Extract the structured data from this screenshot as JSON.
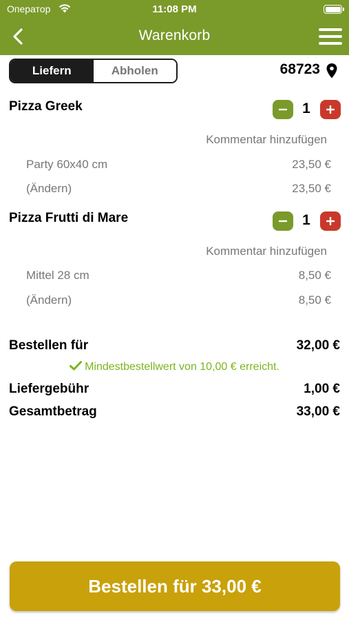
{
  "status_bar": {
    "carrier": "Оператор",
    "time": "11:08 PM"
  },
  "nav": {
    "title": "Warenkorb"
  },
  "tabs": [
    {
      "label": "Liefern",
      "active": true
    },
    {
      "label": "Abholen",
      "active": false
    }
  ],
  "postcode": "68723",
  "items": [
    {
      "name": "Pizza Greek",
      "quantity": "1",
      "comment": "Kommentar hinzufügen",
      "size": "Party 60x40 cm",
      "size_price": "23,50 €",
      "change": "(Ändern)",
      "change_price": "23,50 €"
    },
    {
      "name": "Pizza Frutti di Mare",
      "quantity": "1",
      "comment": "Kommentar hinzufügen",
      "size": "Mittel 28 cm",
      "size_price": "8,50 €",
      "change": "(Ändern)",
      "change_price": "8,50 €"
    }
  ],
  "summary": {
    "order_for_label": "Bestellen für",
    "order_for_value": "32,00 €",
    "minimum_message": "Mindestbestellwert von 10,00 € erreicht.",
    "delivery_fee_label": "Liefergebühr",
    "delivery_fee_value": "1,00 €",
    "total_label": "Gesamtbetrag",
    "total_value": "33,00 €"
  },
  "order_button": {
    "label": "Bestellen für 33,00 €"
  },
  "colors": {
    "header": "#7a9a2a",
    "minus_button": "#7a9a2a",
    "plus_button": "#c8392b",
    "order_button": "#c9a10a",
    "success_text": "#7ab51d"
  }
}
